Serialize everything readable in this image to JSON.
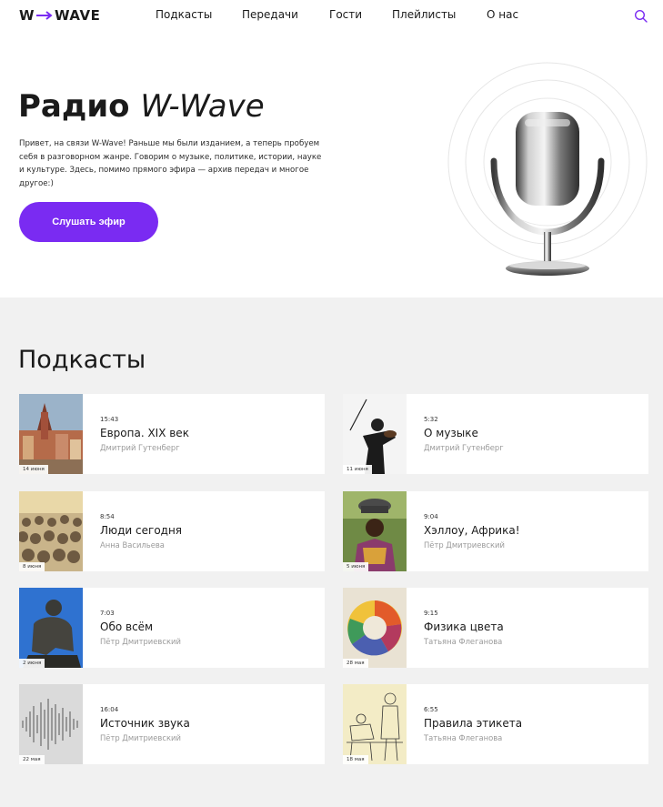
{
  "brand": {
    "logo_left": "W",
    "logo_right": "WAVE",
    "accent": "#7A2BF2"
  },
  "nav": {
    "items": [
      {
        "label": "Подкасты"
      },
      {
        "label": "Передачи"
      },
      {
        "label": "Гости"
      },
      {
        "label": "Плейлисты"
      },
      {
        "label": "О нас"
      }
    ],
    "search_icon": "search-icon"
  },
  "hero": {
    "title_bold": "Радио",
    "title_italic": "W-Wave",
    "description": "Привет, на связи W-Wave! Раньше мы были изданием, а теперь пробуем себя в разговорном жанре. Говорим о музыке, политике, истории, науке и культуре. Здесь, помимо прямого эфира — архив передач и многое другое:)",
    "button_label": "Слушать эфир",
    "art_icon": "microphone-icon"
  },
  "podcasts": {
    "section_title": "Подкасты",
    "items": [
      {
        "date": "14 июня",
        "duration": "15:43",
        "title": "Европа. XIX век",
        "author": "Дмитрий Гутенберг",
        "thumb": "old-town-icon"
      },
      {
        "date": "11 июня",
        "duration": "5:32",
        "title": "О музыке",
        "author": "Дмитрий Гутенберг",
        "thumb": "violinist-icon"
      },
      {
        "date": "8 июня",
        "duration": "8:54",
        "title": "Люди сегодня",
        "author": "Анна Васильева",
        "thumb": "crowd-icon"
      },
      {
        "date": "5 июня",
        "duration": "9:04",
        "title": "Хэллоу, Африка!",
        "author": "Пётр Дмитриевский",
        "thumb": "african-woman-icon"
      },
      {
        "date": "2 июня",
        "duration": "7:03",
        "title": "Обо всём",
        "author": "Пётр Дмитриевский",
        "thumb": "thinker-statue-icon"
      },
      {
        "date": "28 мая",
        "duration": "9:15",
        "title": "Физика цвета",
        "author": "Татьяна Флеганова",
        "thumb": "color-wheel-icon"
      },
      {
        "date": "22 мая",
        "duration": "16:04",
        "title": "Источник звука",
        "author": "Пётр Дмитриевский",
        "thumb": "sound-wave-icon"
      },
      {
        "date": "18 мая",
        "duration": "6:55",
        "title": "Правила этикета",
        "author": "Татьяна Флеганова",
        "thumb": "etiquette-engraving-icon"
      }
    ]
  }
}
